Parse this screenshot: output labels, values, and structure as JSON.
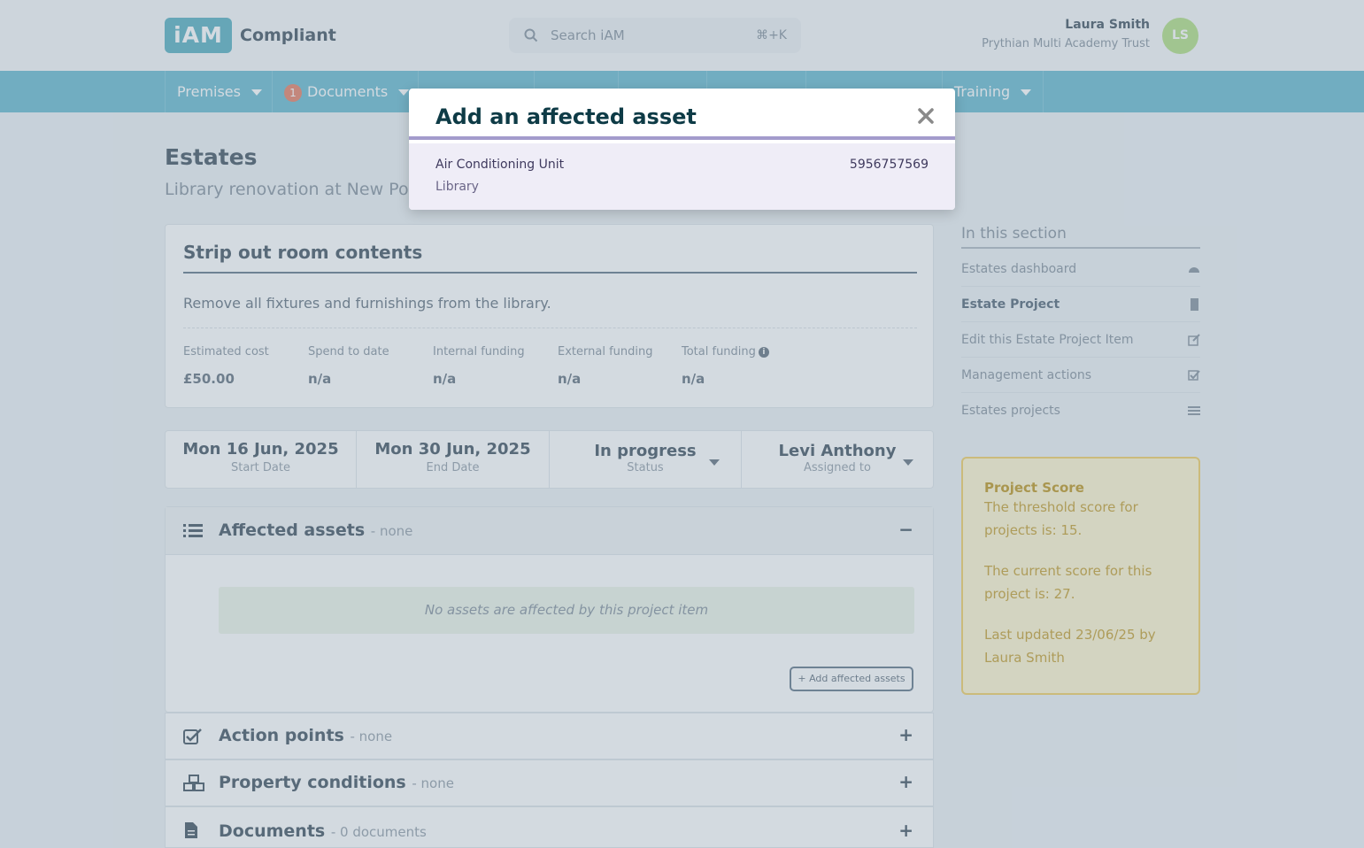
{
  "header": {
    "logo_mark": "iAM",
    "logo_text": "Compliant",
    "search_placeholder": "Search iAM",
    "search_shortcut": "⌘+K",
    "user_name": "Laura Smith",
    "user_org": "Prythian Multi Academy Trust",
    "user_initials": "LS"
  },
  "nav": {
    "items": [
      {
        "label": "Premises",
        "badge": ""
      },
      {
        "label": "Documents",
        "badge": "1"
      },
      {
        "label": "Training",
        "badge": ""
      }
    ]
  },
  "page": {
    "title": "Estates",
    "subtitle": "Library renovation at New Po"
  },
  "item": {
    "title": "Strip out room contents",
    "description": "Remove all fixtures and furnishings from the library.",
    "funding": [
      {
        "label": "Estimated cost",
        "value": "£50.00"
      },
      {
        "label": "Spend to date",
        "value": "n/a"
      },
      {
        "label": "Internal funding",
        "value": "n/a"
      },
      {
        "label": "External funding",
        "value": "n/a"
      },
      {
        "label": "Total funding",
        "value": "n/a"
      }
    ]
  },
  "dates": [
    {
      "main": "Mon 16 Jun, 2025",
      "sub": "Start Date"
    },
    {
      "main": "Mon 30 Jun, 2025",
      "sub": "End Date"
    },
    {
      "main": "In progress",
      "sub": "Status"
    },
    {
      "main": "Levi Anthony",
      "sub": "Assigned to"
    }
  ],
  "assets_panel": {
    "title": "Affected assets",
    "note": "- none",
    "toggle": "−",
    "empty_message": "No assets are affected by this project item",
    "add_button": "+ Add affected assets"
  },
  "panels": [
    {
      "title": "Action points",
      "note": "- none",
      "toggle": "+"
    },
    {
      "title": "Property conditions",
      "note": "- none",
      "toggle": "+"
    },
    {
      "title": "Documents",
      "note": "- 0 documents",
      "toggle": "+"
    }
  ],
  "sidebar": {
    "heading": "In this section",
    "items": [
      {
        "label": "Estates dashboard"
      },
      {
        "label": "Estate Project"
      },
      {
        "label": "Edit this Estate Project Item"
      },
      {
        "label": "Management actions"
      },
      {
        "label": "Estates projects"
      }
    ]
  },
  "score": {
    "title": "Project Score",
    "threshold": "The threshold score for projects is: 15.",
    "current": "The current score for this project is: 27.",
    "updated": "Last updated 23/06/25 by Laura Smith"
  },
  "modal": {
    "title": "Add an affected asset",
    "asset_name": "Air Conditioning Unit",
    "asset_id": "5956757569",
    "asset_location": "Library"
  }
}
